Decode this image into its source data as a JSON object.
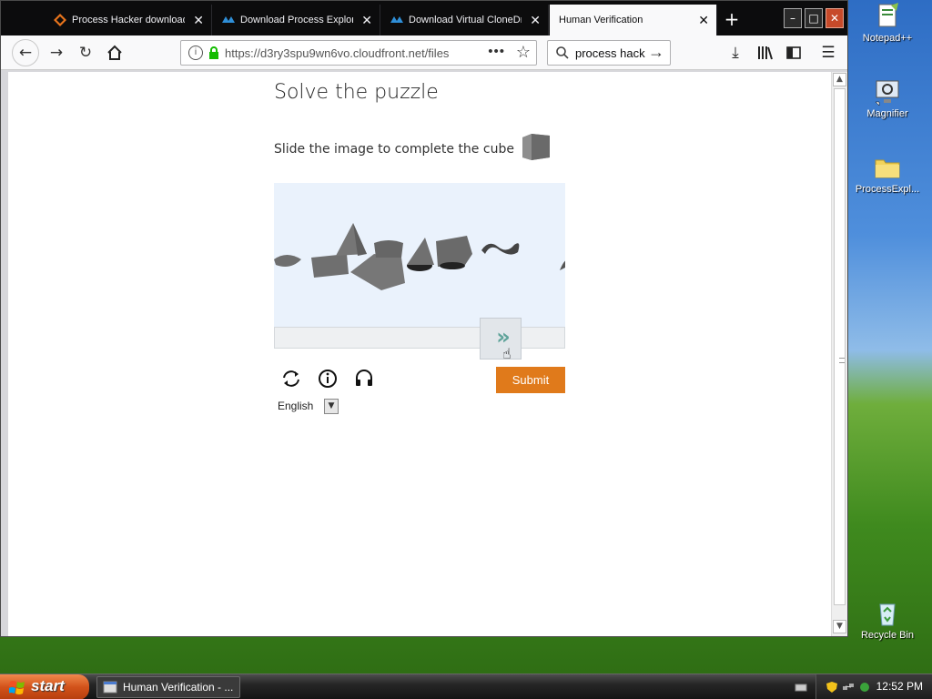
{
  "desktop": {
    "icons": [
      {
        "label": "Notepad++"
      },
      {
        "label": "Magnifier"
      },
      {
        "label": "ProcessExpl..."
      },
      {
        "label": "Recycle Bin"
      }
    ]
  },
  "browser": {
    "tabs": [
      {
        "label": "Process Hacker download",
        "active": false
      },
      {
        "label": "Download Process Explorer",
        "active": false
      },
      {
        "label": "Download Virtual CloneDrive",
        "active": false
      },
      {
        "label": "Human Verification",
        "active": true
      }
    ],
    "url": "https://d3ry3spu9wn6vo.cloudfront.net/files",
    "search_text": "process hack",
    "new_tab_symbol": "+"
  },
  "puzzle": {
    "title": "Solve the puzzle",
    "instruction": "Slide the image to complete the cube",
    "submit_label": "Submit",
    "language": "English",
    "slider_chevron": "»"
  },
  "taskbar": {
    "start_label": "start",
    "task_label": "Human Verification - ...",
    "clock": "12:52 PM"
  },
  "colors": {
    "submit": "#e07a1b",
    "slider_accent": "#5fa39a",
    "puzzle_bg": "#eaf2fc"
  }
}
